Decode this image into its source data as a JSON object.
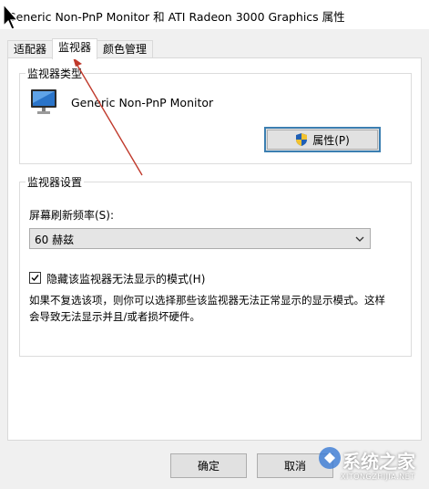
{
  "window": {
    "title": "Generic Non-PnP Monitor 和 ATI Radeon 3000 Graphics 属性"
  },
  "tabs": [
    {
      "label": "适配器",
      "active": false
    },
    {
      "label": "监视器",
      "active": true
    },
    {
      "label": "颜色管理",
      "active": false
    }
  ],
  "monitor_type": {
    "legend": "监视器类型",
    "monitor_name": "Generic Non-PnP Monitor",
    "properties_button": "属性(P)",
    "icons": [
      "monitor-icon",
      "shield-icon"
    ]
  },
  "monitor_settings": {
    "legend": "监视器设置",
    "refresh_label": "屏幕刷新频率(S):",
    "refresh_value": "60 赫兹",
    "hide_modes_checked": true,
    "hide_modes_label": "隐藏该监视器无法显示的模式(H)",
    "description": "如果不复选该项，则你可以选择那些该监视器无法正常显示的显示模式。这样会导致无法显示并且/或者损坏硬件。"
  },
  "buttons": {
    "ok": "确定",
    "cancel": "取消"
  },
  "watermark": {
    "text": "系统之家",
    "sub": "XITONGZHIJIA.NET"
  },
  "colors": {
    "accent_border": "#3c7fb1",
    "annotation_arrow": "#c0392b",
    "dialog_bg": "#f0f0f0"
  }
}
